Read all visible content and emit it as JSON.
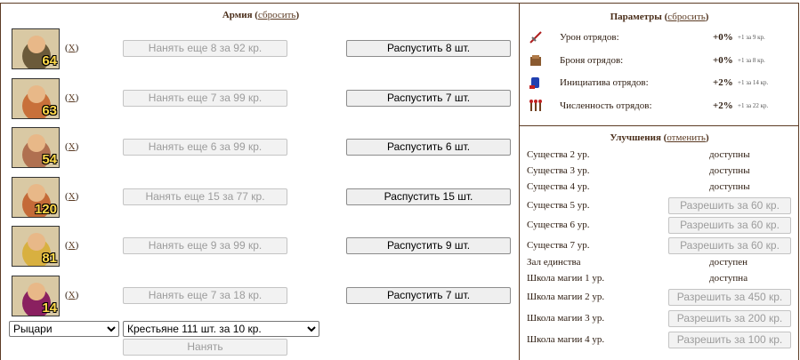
{
  "army": {
    "title": "Армия",
    "reset_label": "сбросить",
    "units": [
      {
        "count": "64",
        "remove_label": "X",
        "hire_label": "Нанять еще 8 за 92 кр.",
        "dismiss_label": "Распустить 8 шт.",
        "color": "#6b5a3a"
      },
      {
        "count": "63",
        "remove_label": "X",
        "hire_label": "Нанять еще 7 за 99 кр.",
        "dismiss_label": "Распустить 7 шт.",
        "color": "#c8703a"
      },
      {
        "count": "54",
        "remove_label": "X",
        "hire_label": "Нанять еще 6 за 99 кр.",
        "dismiss_label": "Распустить 6 шт.",
        "color": "#b07050"
      },
      {
        "count": "120",
        "remove_label": "X",
        "hire_label": "Нанять еще 15 за 77 кр.",
        "dismiss_label": "Распустить 15 шт.",
        "color": "#c46a38"
      },
      {
        "count": "81",
        "remove_label": "X",
        "hire_label": "Нанять еще 9 за 99 кр.",
        "dismiss_label": "Распустить 9 шт.",
        "color": "#d8b040"
      },
      {
        "count": "14",
        "remove_label": "X",
        "hire_label": "Нанять еще 7 за 18 кр.",
        "dismiss_label": "Распустить 7 шт.",
        "color": "#8a2060"
      }
    ],
    "faction_select": "Рыцари",
    "unit_select": "Крестьяне 111 шт. за 10 кр.",
    "hire_button": "Нанять"
  },
  "params": {
    "title": "Параметры",
    "reset_label": "сбросить",
    "rows": [
      {
        "name": "Урон отрядов:",
        "value": "+0%",
        "sub": "+1 за 9 кр.",
        "icon": "sword-icon"
      },
      {
        "name": "Броня отрядов:",
        "value": "+0%",
        "sub": "+1 за 8 кр.",
        "icon": "armor-icon"
      },
      {
        "name": "Инициатива отрядов:",
        "value": "+2%",
        "sub": "+1 за 14 кр.",
        "icon": "initiative-icon"
      },
      {
        "name": "Численность отрядов:",
        "value": "+2%",
        "sub": "+1 за 22 кр.",
        "icon": "troops-icon"
      }
    ]
  },
  "upgrades": {
    "title": "Улучшения",
    "cancel_label": "отменить",
    "rows": [
      {
        "name": "Существа 2 ур.",
        "status": "доступны"
      },
      {
        "name": "Существа 3 ур.",
        "status": "доступны"
      },
      {
        "name": "Существа 4 ур.",
        "status": "доступны"
      },
      {
        "name": "Существа 5 ур.",
        "button": "Разрешить за 60 кр."
      },
      {
        "name": "Существа 6 ур.",
        "button": "Разрешить за 60 кр."
      },
      {
        "name": "Существа 7 ур.",
        "button": "Разрешить за 60 кр."
      },
      {
        "name": "Зал единства",
        "status": "доступен"
      },
      {
        "name": "Школа магии 1 ур.",
        "status": "доступна"
      },
      {
        "name": "Школа магии 2 ур.",
        "button": "Разрешить за 450 кр."
      },
      {
        "name": "Школа магии 3 ур.",
        "button": "Разрешить за 200 кр."
      },
      {
        "name": "Школа магии 4 ур.",
        "button": "Разрешить за 100 кр."
      }
    ]
  }
}
